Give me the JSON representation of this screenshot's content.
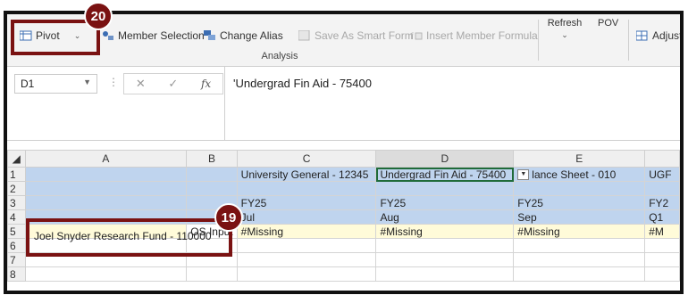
{
  "ribbon": {
    "pivot_label": "Pivot",
    "member_selection_label": "Member Selection",
    "change_alias_label": "Change Alias",
    "save_as_smart_form_label": "Save As Smart Form",
    "insert_member_formula_label": "Insert Member Formula",
    "group_label": "Analysis",
    "refresh_label": "Refresh",
    "pov_label": "POV",
    "adjust_label": "Adjust"
  },
  "formula_bar": {
    "name_box": "D1",
    "content": "'Undergrad Fin Aid - 75400",
    "fx_label": "fx"
  },
  "grid": {
    "columns": [
      "A",
      "B",
      "C",
      "D",
      "E",
      ""
    ],
    "rows": [
      {
        "num": "1",
        "cells": [
          "",
          "",
          "University General - 12345",
          "Undergrad Fin Aid - 75400",
          "lance Sheet - 010",
          "UGF"
        ]
      },
      {
        "num": "2",
        "cells": [
          "",
          "",
          "",
          "",
          "",
          ""
        ]
      },
      {
        "num": "3",
        "cells": [
          "",
          "",
          "FY25",
          "FY25",
          "FY25",
          "FY2"
        ]
      },
      {
        "num": "4",
        "cells": [
          "",
          "",
          "Jul",
          "Aug",
          "Sep",
          "Q1"
        ]
      },
      {
        "num": "5",
        "cells": [
          "",
          "OS Input",
          "#Missing",
          "#Missing",
          "#Missing",
          "#M"
        ]
      },
      {
        "num": "6",
        "cells": [
          "",
          "",
          "",
          "",
          "",
          ""
        ]
      },
      {
        "num": "7",
        "cells": [
          "",
          "",
          "",
          "",
          "",
          ""
        ]
      },
      {
        "num": "8",
        "cells": [
          "",
          "",
          "",
          "",
          "",
          ""
        ]
      }
    ],
    "a5_text": "Joel Snyder Research Fund - 110000"
  },
  "callouts": {
    "badge_top": "20",
    "badge_bottom": "19"
  },
  "colors": {
    "callout": "#7a1212",
    "header_blue": "#bfd4ee",
    "data_yellow": "#fffbd9"
  }
}
